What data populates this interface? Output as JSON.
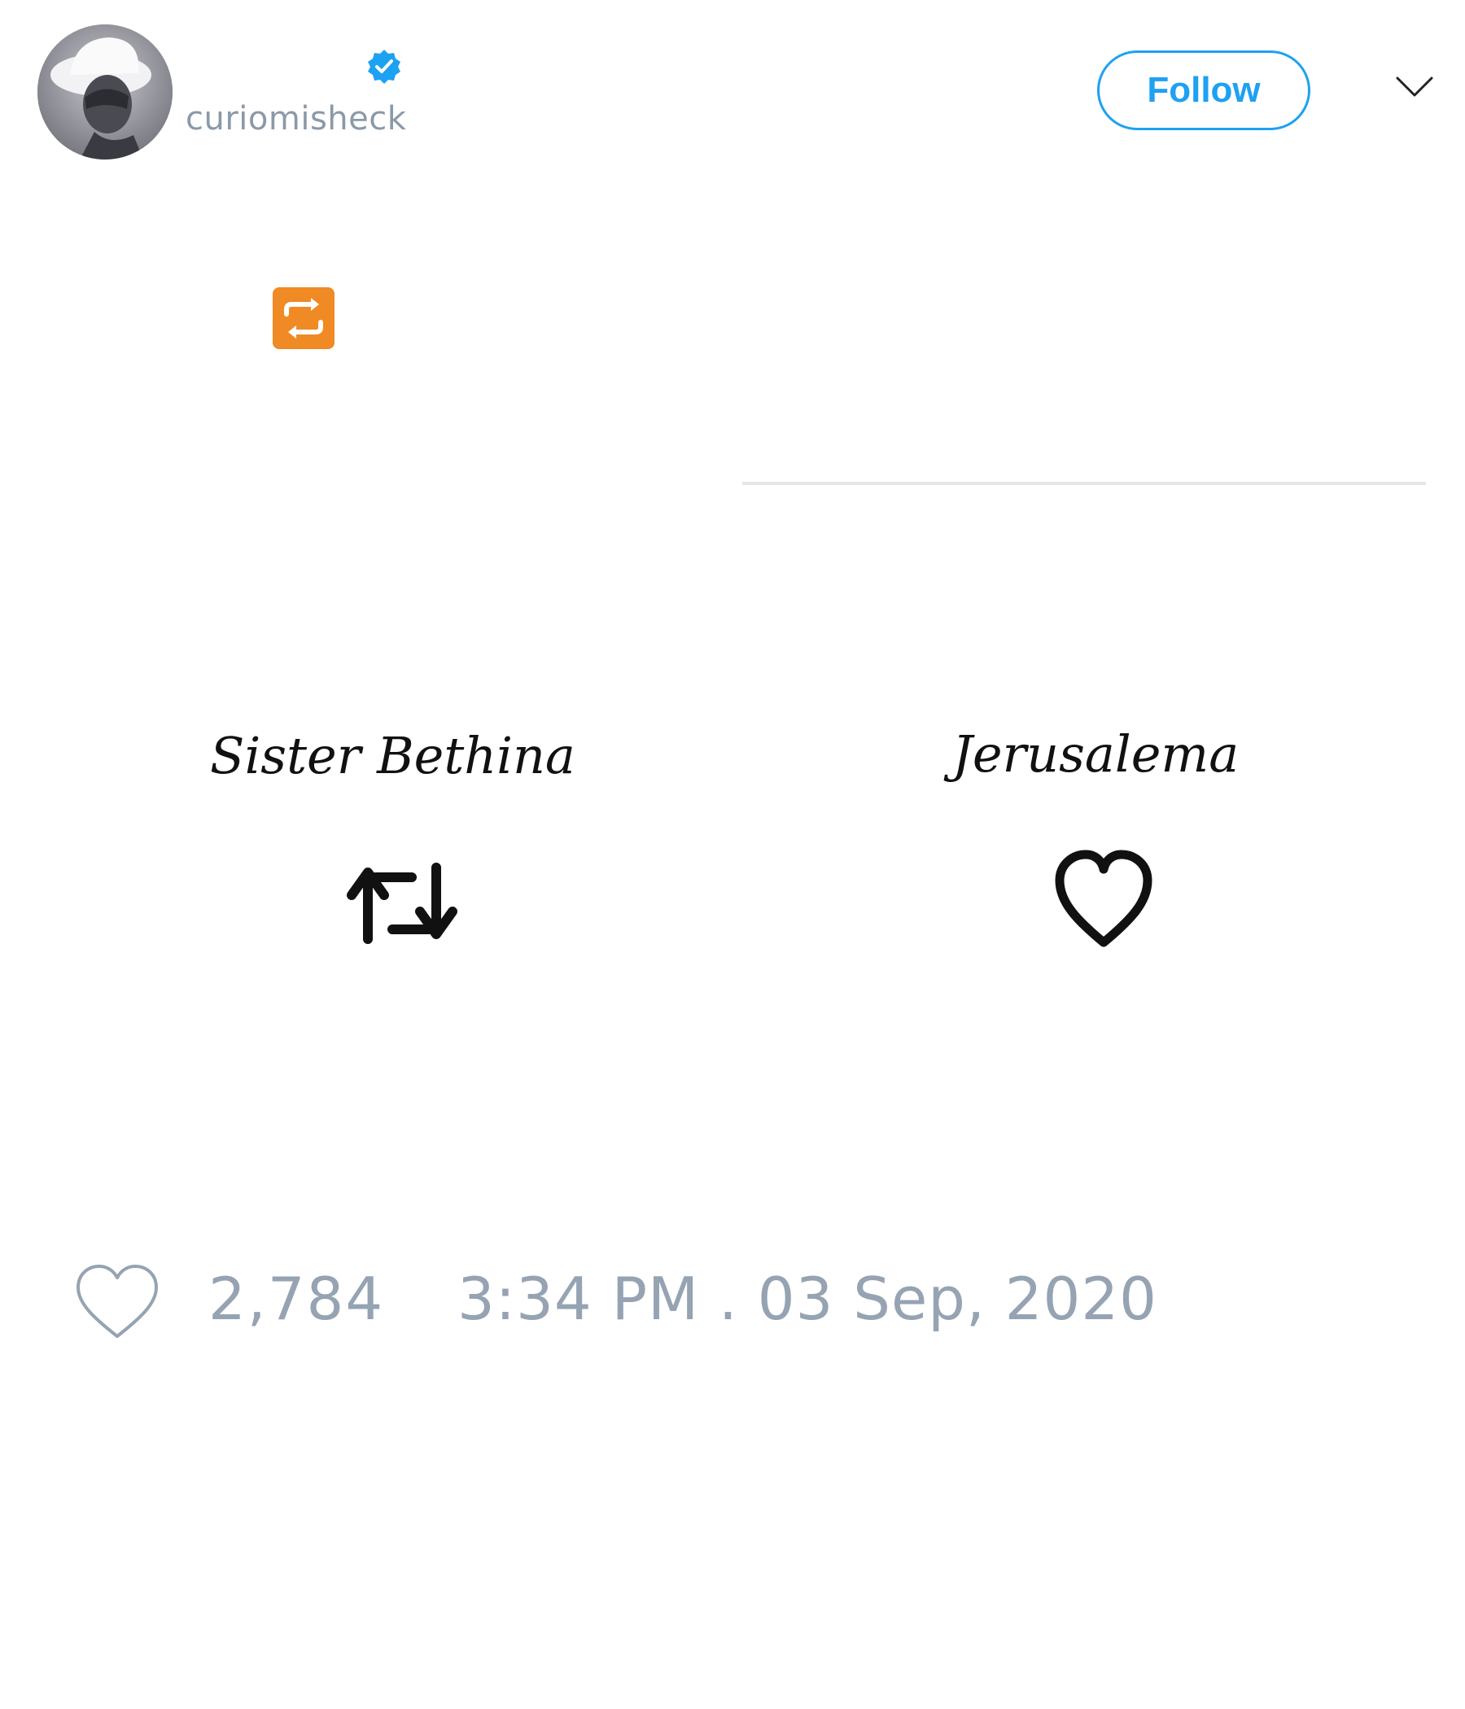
{
  "user": {
    "handle": "curiomisheck",
    "verified": true
  },
  "header": {
    "follow_label": "Follow",
    "menu_icon": "chevron-down-icon"
  },
  "tweet": {
    "emoji": "repeat-emoji-icon"
  },
  "media": {
    "left_label": "Sister Bethina",
    "right_label": "Jerusalema",
    "left_icon": "retweet-icon",
    "right_icon": "heart-icon"
  },
  "footer": {
    "likes": "2,784",
    "timestamp": "3:34 PM . 03 Sep, 2020"
  },
  "colors": {
    "accent": "#1da1f2",
    "muted": "#95a3b3",
    "emoji": "#f08a24"
  }
}
